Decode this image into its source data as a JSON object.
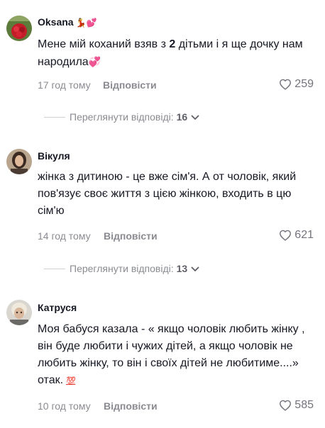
{
  "comments": [
    {
      "username": "Oksana",
      "username_emojis": "💃💕",
      "text_parts": [
        "Мене мій коханий взяв з ",
        "2",
        " дітьми і я ще дочку нам народила"
      ],
      "text_emoji": "💞",
      "time": "17 год тому",
      "reply_label": "Відповісти",
      "likes": "259",
      "view_replies_label": "Переглянути відповіді:",
      "reply_count": "16"
    },
    {
      "username": "Вікуля",
      "text": "жінка з дитиною - це вже сім'я. А от чоловік, який пов'язує своє життя з цією жінкою, входить в цю сім'ю",
      "time": "14 год тому",
      "reply_label": "Відповісти",
      "likes": "621",
      "view_replies_label": "Переглянути відповіді:",
      "reply_count": "13"
    },
    {
      "username": "Катруся",
      "text": "Моя бабуся казала - « якщо чоловік любить жінку , він буде любити і чужих дітей, а якщо чоловік не любить жінку, то він і своїх дітей не любитиме....» отак.",
      "text_emoji": "💯",
      "time": "10 год тому",
      "reply_label": "Відповісти",
      "likes": "585"
    }
  ],
  "icons": {
    "like": "heart-outline-icon",
    "expand": "chevron-down-icon"
  },
  "colors": {
    "text": "#161823",
    "muted": "#8a8b91",
    "heart_emoji": "#e83d84"
  }
}
